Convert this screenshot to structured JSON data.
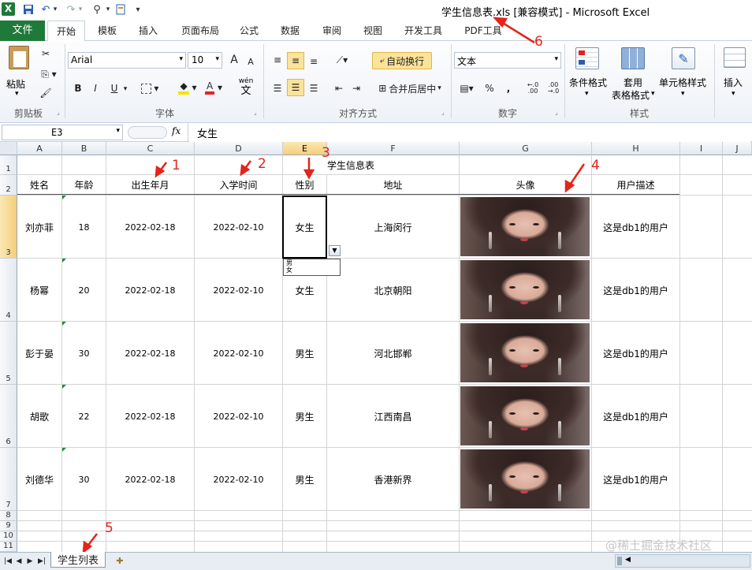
{
  "window": {
    "title": "学生信息表.xls  [兼容模式]  -  Microsoft Excel"
  },
  "quick_access": {
    "app_icon": "excel-logo-icon",
    "undo": "↶",
    "redo": "↷",
    "dropdown": "▾"
  },
  "ribbon_tabs": [
    {
      "label": "文件"
    },
    {
      "label": "开始"
    },
    {
      "label": "模板"
    },
    {
      "label": "插入"
    },
    {
      "label": "页面布局"
    },
    {
      "label": "公式"
    },
    {
      "label": "数据"
    },
    {
      "label": "审阅"
    },
    {
      "label": "视图"
    },
    {
      "label": "开发工具"
    },
    {
      "label": "PDF工具"
    }
  ],
  "ribbon": {
    "clipboard": {
      "paste": "粘贴",
      "group": "剪贴板"
    },
    "font": {
      "name": "Arial",
      "size": "10",
      "group": "字体",
      "bold": "B",
      "italic": "I",
      "underline": "U",
      "grow": "A",
      "shrink": "A",
      "wen": "wén",
      "wen_char": "文"
    },
    "alignment": {
      "wrap": "自动换行",
      "merge": "合并后居中",
      "group": "对齐方式"
    },
    "number": {
      "format": "文本",
      "percent": "%",
      "comma": ",",
      "inc": "+.0 .00",
      "dec": ".00 →.0",
      "group": "数字"
    },
    "styles": {
      "conditional": "条件格式",
      "table": "套用",
      "table2": "表格格式",
      "cell": "单元格样式",
      "group": "样式"
    },
    "cells": {
      "insert": "插入"
    }
  },
  "formula_bar": {
    "name_box": "E3",
    "fx": "fx",
    "content": "女生"
  },
  "columns": [
    "A",
    "B",
    "C",
    "D",
    "E",
    "F",
    "G",
    "H",
    "I",
    "J"
  ],
  "sheet": {
    "title": "学生信息表",
    "headers": [
      "姓名",
      "年龄",
      "出生年月",
      "入学时间",
      "性别",
      "地址",
      "头像",
      "用户描述"
    ],
    "rows": [
      {
        "name": "刘亦菲",
        "age": "18",
        "birth": "2022-02-18",
        "enroll": "2022-02-10",
        "gender": "女生",
        "address": "上海闵行",
        "desc": "这是db1的用户"
      },
      {
        "name": "杨幂",
        "age": "20",
        "birth": "2022-02-18",
        "enroll": "2022-02-10",
        "gender": "女生",
        "address": "北京朝阳",
        "desc": "这是db1的用户"
      },
      {
        "name": "彭于晏",
        "age": "30",
        "birth": "2022-02-18",
        "enroll": "2022-02-10",
        "gender": "男生",
        "address": "河北邯郸",
        "desc": "这是db1的用户"
      },
      {
        "name": "胡歌",
        "age": "22",
        "birth": "2022-02-18",
        "enroll": "2022-02-10",
        "gender": "男生",
        "address": "江西南昌",
        "desc": "这是db1的用户"
      },
      {
        "name": "刘德华",
        "age": "30",
        "birth": "2022-02-18",
        "enroll": "2022-02-10",
        "gender": "男生",
        "address": "香港新界",
        "desc": "这是db1的用户"
      }
    ],
    "row_numbers": [
      "1",
      "2",
      "3",
      "4",
      "5",
      "6",
      "7",
      "8",
      "9",
      "10",
      "11"
    ],
    "dropdown_options": [
      "男",
      "女"
    ]
  },
  "sheet_tabs": [
    {
      "label": "学生列表"
    }
  ],
  "annotations": [
    "1",
    "2",
    "3",
    "4",
    "5",
    "6"
  ],
  "watermark": "@稀土掘金技术社区",
  "colors": {
    "accent": "#1f7a3a",
    "annotation": "#e3241b",
    "selection": "#fbe39a"
  }
}
